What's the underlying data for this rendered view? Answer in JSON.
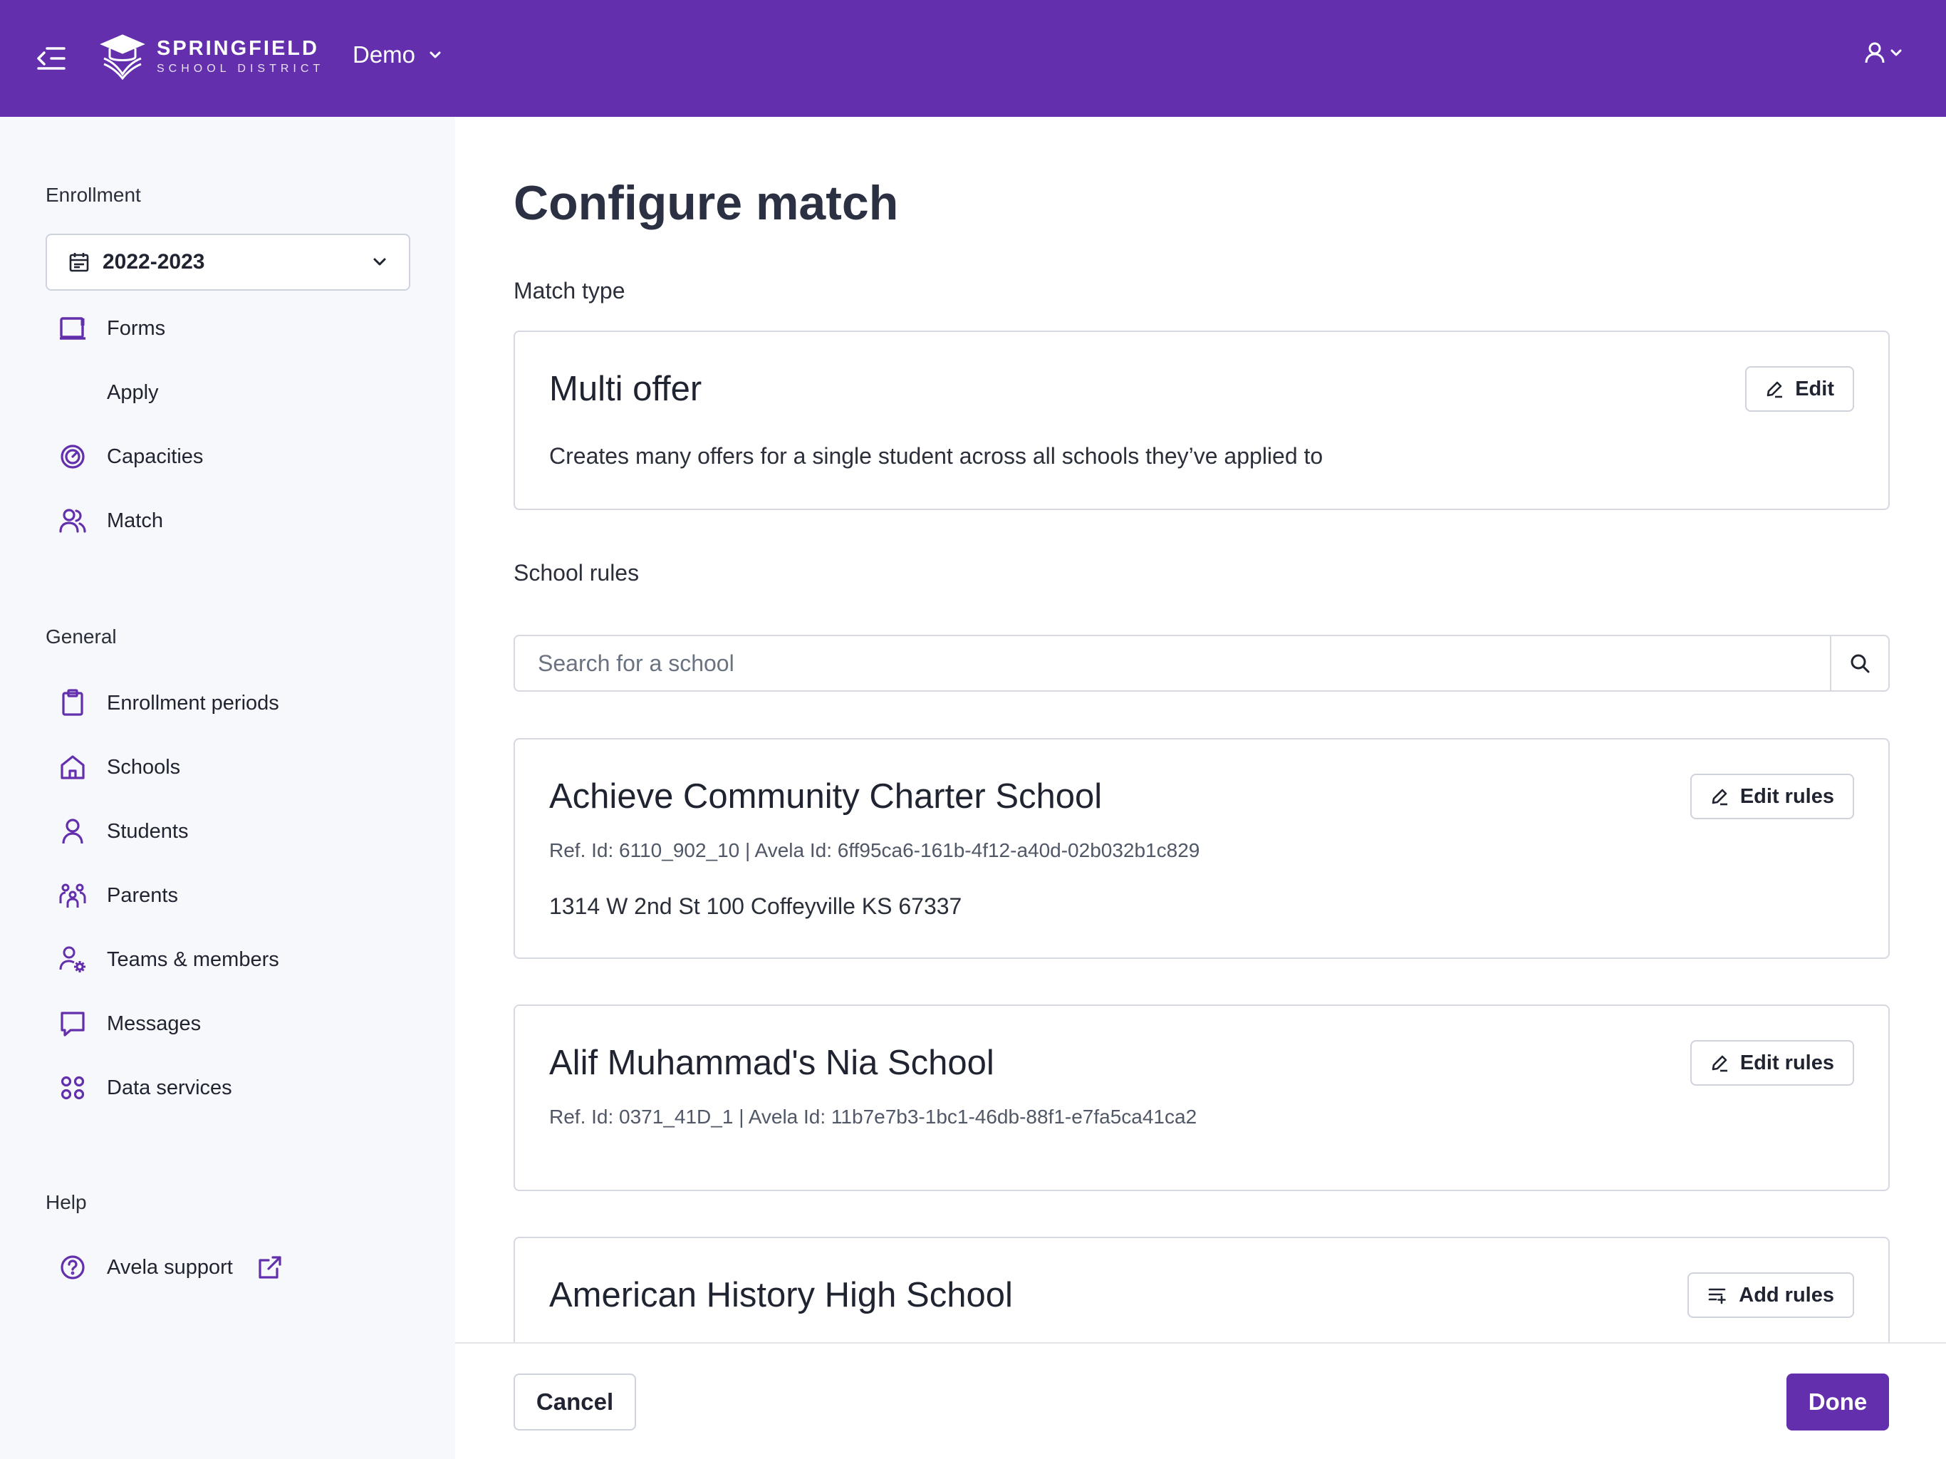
{
  "header": {
    "logo_name": "SPRINGFIELD",
    "logo_sub": "SCHOOL DISTRICT",
    "org_name": "Demo",
    "brand_color": "#632fac"
  },
  "sidebar": {
    "enrollment_heading": "Enrollment",
    "year_value": "2022-2023",
    "enrollment_items": [
      {
        "label": "Forms",
        "icon": "forms-icon"
      },
      {
        "label": "Apply",
        "icon": ""
      },
      {
        "label": "Capacities",
        "icon": "gauge-icon"
      },
      {
        "label": "Match",
        "icon": "users-icon"
      }
    ],
    "general_heading": "General",
    "general_items": [
      {
        "label": "Enrollment periods",
        "icon": "clipboard-icon"
      },
      {
        "label": "Schools",
        "icon": "home-icon"
      },
      {
        "label": "Students",
        "icon": "user-icon"
      },
      {
        "label": "Parents",
        "icon": "family-icon"
      },
      {
        "label": "Teams & members",
        "icon": "user-gear-icon"
      },
      {
        "label": "Messages",
        "icon": "message-icon"
      },
      {
        "label": "Data services",
        "icon": "command-icon"
      }
    ],
    "help_heading": "Help",
    "help_items": [
      {
        "label": "Avela support",
        "icon": "help-circle-icon"
      }
    ]
  },
  "main": {
    "title": "Configure match",
    "match_type_label": "Match type",
    "match_type": {
      "title": "Multi offer",
      "description": "Creates many offers for a single student across all schools they’ve applied to",
      "edit_label": "Edit"
    },
    "school_rules_label": "School rules",
    "search_placeholder": "Search for a school",
    "schools": [
      {
        "name": "Achieve Community Charter School",
        "ids": "Ref. Id: 6110_902_10 | Avela Id: 6ff95ca6-161b-4f12-a40d-02b032b1c829",
        "address": "1314 W 2nd St 100 Coffeyville KS 67337",
        "button_label": "Edit rules"
      },
      {
        "name": "Alif Muhammad's Nia School",
        "ids": "Ref. Id: 0371_41D_1 | Avela Id: 11b7e7b3-1bc1-46db-88f1-e7fa5ca41ca2",
        "address": "",
        "button_label": "Edit rules"
      },
      {
        "name": "American History High School",
        "ids": "",
        "address": "",
        "button_label": "Add rules"
      }
    ]
  },
  "footer": {
    "cancel_label": "Cancel",
    "done_label": "Done"
  }
}
